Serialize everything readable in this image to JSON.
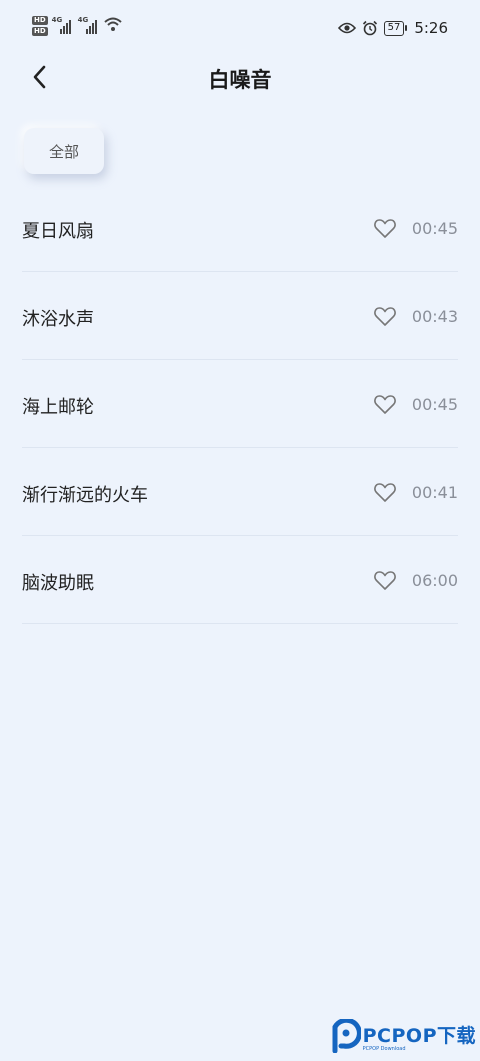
{
  "status_bar": {
    "network_badge_1": "HD",
    "network_badge_2": "HD",
    "signal_1": "4G",
    "signal_2": "4G",
    "battery": "57",
    "time": "5:26"
  },
  "header": {
    "title": "白噪音"
  },
  "filter": {
    "chip_label": "全部"
  },
  "sounds": [
    {
      "title": "夏日风扇",
      "duration": "00:45"
    },
    {
      "title": "沐浴水声",
      "duration": "00:43"
    },
    {
      "title": "海上邮轮",
      "duration": "00:45"
    },
    {
      "title": "渐行渐远的火车",
      "duration": "00:41"
    },
    {
      "title": "脑波助眠",
      "duration": "06:00"
    }
  ],
  "watermark": {
    "text": "PCPOP下载",
    "sub": "PCPOP Download"
  },
  "colors": {
    "background": "#edf3fc",
    "text_primary": "#222222",
    "text_secondary": "#8a8f99",
    "divider": "#dde5f1",
    "watermark": "#1565c0"
  }
}
